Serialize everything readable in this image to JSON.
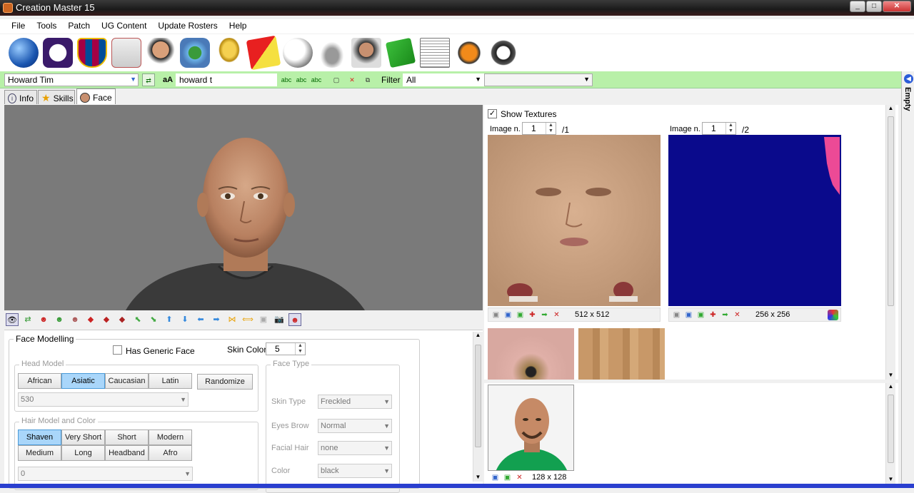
{
  "window": {
    "title": "Creation Master 15"
  },
  "menu": [
    "File",
    "Tools",
    "Patch",
    "UG Content",
    "Update Rosters",
    "Help"
  ],
  "toolbar_icons": [
    "globe-icon",
    "premier-league-icon",
    "barcelona-crest-icon",
    "jersey-icon",
    "player-portrait-icon",
    "stadium-icon",
    "trophy-icon",
    "referee-card-icon",
    "ball-icon",
    "boots-icon",
    "manager-portrait-icon",
    "pitch-icon",
    "newspaper-icon",
    "gloves-icon",
    "headphones-icon"
  ],
  "filterbar": {
    "player_name": "Howard Tim",
    "search_text": "howard t",
    "filter_label": "Filter",
    "filter_value": "All",
    "case_btn": "aA"
  },
  "tabs": [
    "Info",
    "Skills",
    "Face"
  ],
  "right_strip": {
    "label": "Empty"
  },
  "face_modelling": {
    "title": "Face Modelling",
    "has_generic_face": "Has Generic Face",
    "skin_color_label": "Skin Color",
    "skin_color_value": "5",
    "head_model": {
      "title": "Head Model",
      "options": [
        "African",
        "Asiatic",
        "Caucasian",
        "Latin"
      ],
      "selected": "Asiatic",
      "randomize": "Randomize",
      "model_value": "530"
    },
    "hair": {
      "title": "Hair Model and Color",
      "options": [
        "Shaven",
        "Very Short",
        "Short",
        "Modern",
        "Medium",
        "Long",
        "Headband",
        "Afro"
      ],
      "selected": "Shaven",
      "value": "0"
    },
    "face_type": {
      "title": "Face Type",
      "skin_type_label": "Skin Type",
      "skin_type": "Freckled",
      "eyes_brow_label": "Eyes Brow",
      "eyes_brow": "Normal",
      "facial_hair_label": "Facial Hair",
      "facial_hair": "none",
      "color_label": "Color",
      "color": "black"
    }
  },
  "textures": {
    "show_label": "Show Textures",
    "left": {
      "image_label": "Image n.",
      "index": "1",
      "total": "/1",
      "size": "512 x 512"
    },
    "right": {
      "image_label": "Image n.",
      "index": "1",
      "total": "/2",
      "size": "256 x 256"
    },
    "portrait_size": "128 x 128"
  },
  "colors": {
    "filterbar": "#b8f0a8",
    "selected": "#a9d6fa",
    "texture_blue": "#0a0a8c",
    "accent": "#2a3fcf"
  }
}
